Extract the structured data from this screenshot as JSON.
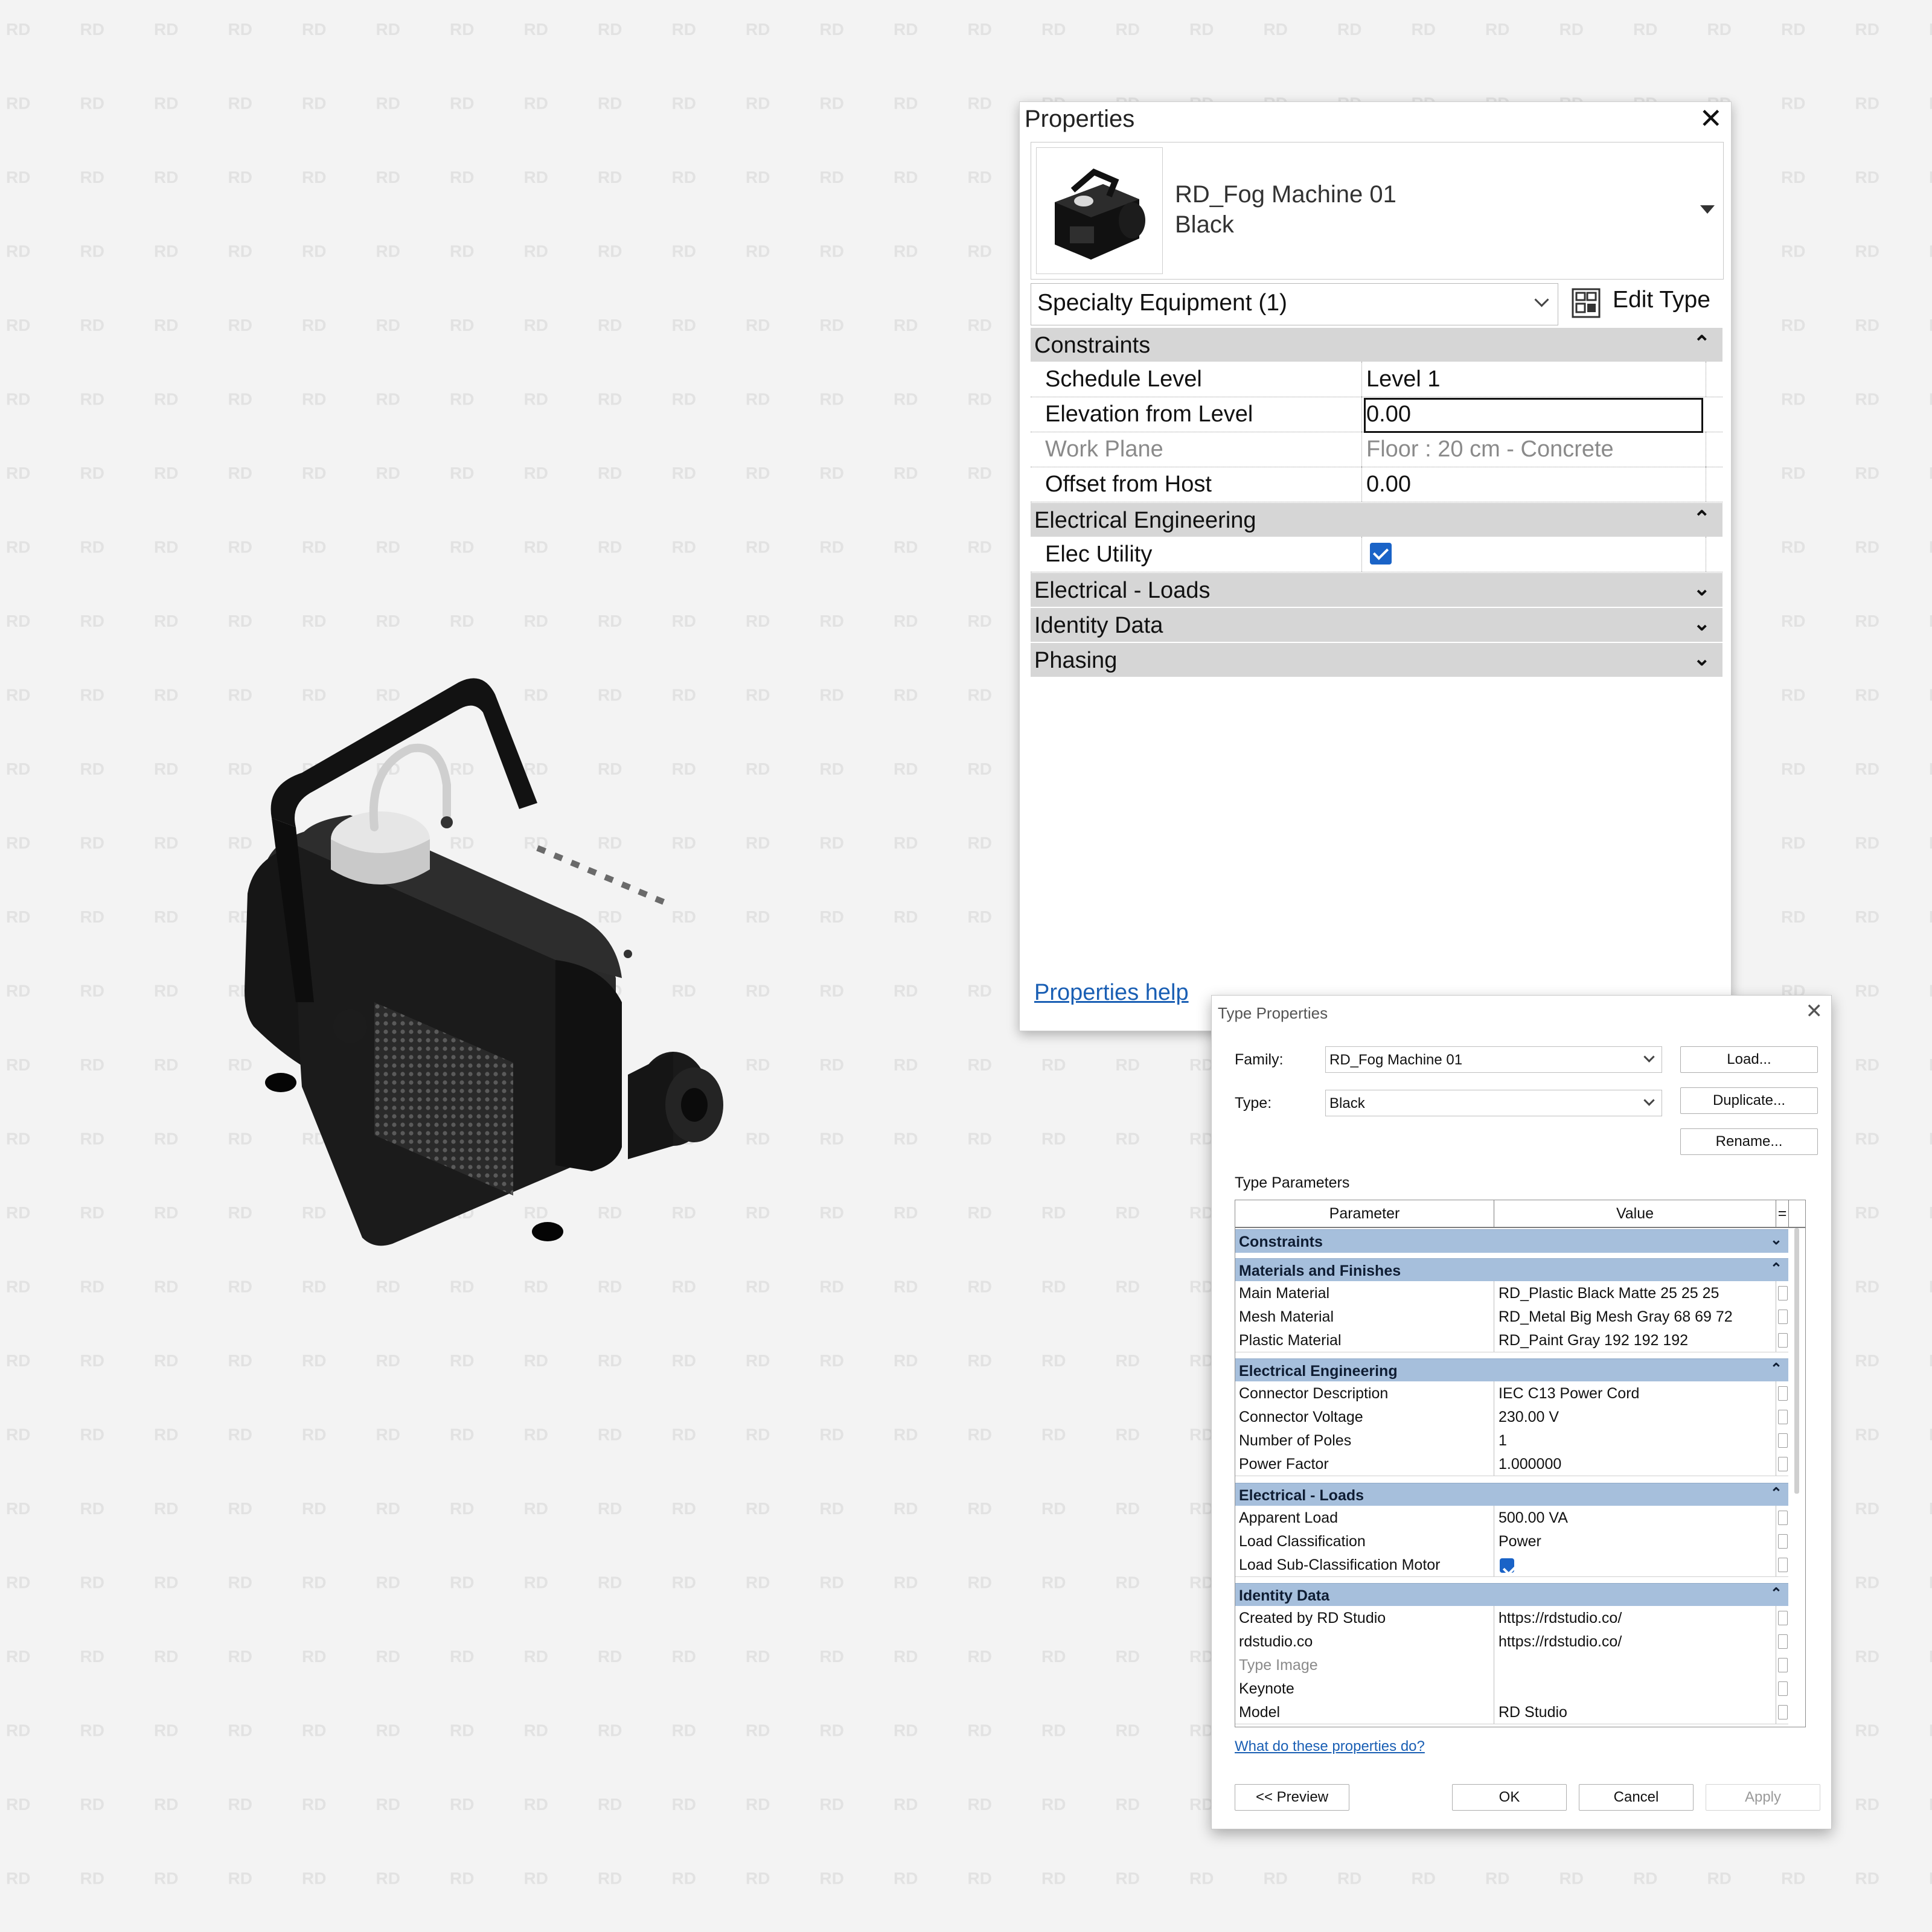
{
  "watermark": {
    "text": "RD"
  },
  "properties_palette": {
    "title": "Properties",
    "type_selector": {
      "family": "RD_Fog Machine 01",
      "type": "Black"
    },
    "category_filter": "Specialty Equipment (1)",
    "edit_type_label": "Edit Type",
    "groups": {
      "constraints": {
        "label": "Constraints",
        "expanded": true,
        "rows": [
          {
            "name": "Schedule Level",
            "value": "Level 1",
            "enabled": true
          },
          {
            "name": "Elevation from Level",
            "value": "0.00",
            "enabled": true
          },
          {
            "name": "Work Plane",
            "value": "Floor : 20 cm - Concrete",
            "enabled": false
          },
          {
            "name": "Offset from Host",
            "value": "0.00",
            "enabled": true
          }
        ]
      },
      "electrical_engineering": {
        "label": "Electrical Engineering",
        "expanded": true,
        "rows": [
          {
            "name": "Elec Utility",
            "checked": true
          }
        ]
      },
      "electrical_loads": {
        "label": "Electrical - Loads",
        "expanded": false
      },
      "identity_data": {
        "label": "Identity Data",
        "expanded": false
      },
      "phasing": {
        "label": "Phasing",
        "expanded": false
      }
    },
    "help_link": "Properties help"
  },
  "type_properties": {
    "title": "Type Properties",
    "family_label": "Family:",
    "family_value": "RD_Fog Machine 01",
    "type_label": "Type:",
    "type_value": "Black",
    "buttons": {
      "load": "Load...",
      "duplicate": "Duplicate...",
      "rename": "Rename..."
    },
    "type_parameters_label": "Type Parameters",
    "columns": {
      "parameter": "Parameter",
      "value": "Value",
      "extra": "="
    },
    "groups": {
      "constraints": {
        "label": "Constraints"
      },
      "materials": {
        "label": "Materials and Finishes",
        "rows": [
          {
            "name": "Main Material",
            "value": "RD_Plastic Black Matte 25 25 25"
          },
          {
            "name": "Mesh Material",
            "value": "RD_Metal Big Mesh Gray 68 69 72"
          },
          {
            "name": "Plastic Material",
            "value": "RD_Paint Gray 192 192 192"
          }
        ]
      },
      "electrical_engineering": {
        "label": "Electrical Engineering",
        "rows": [
          {
            "name": "Connector Description",
            "value": "IEC C13 Power Cord"
          },
          {
            "name": "Connector Voltage",
            "value": "230.00 V"
          },
          {
            "name": "Number of Poles",
            "value": "1"
          },
          {
            "name": "Power Factor",
            "value": "1.000000"
          }
        ]
      },
      "electrical_loads": {
        "label": "Electrical - Loads",
        "rows": [
          {
            "name": "Apparent Load",
            "value": "500.00 VA"
          },
          {
            "name": "Load Classification",
            "value": "Power"
          },
          {
            "name": "Load Sub-Classification Motor",
            "checked": true
          }
        ]
      },
      "identity_data": {
        "label": "Identity Data",
        "rows": [
          {
            "name": "Created by RD Studio",
            "value": "https://rdstudio.co/"
          },
          {
            "name": "rdstudio.co",
            "value": "https://rdstudio.co/"
          },
          {
            "name": "Type Image",
            "value": ""
          },
          {
            "name": "Keynote",
            "value": ""
          },
          {
            "name": "Model",
            "value": "RD Studio"
          }
        ]
      }
    },
    "help_link": "What do these properties do?",
    "footer_buttons": {
      "preview": "<< Preview",
      "ok": "OK",
      "cancel": "Cancel",
      "apply": "Apply"
    }
  },
  "icons": [
    "close-icon",
    "chevron-down-icon",
    "edit-type-icon",
    "collapse-icon",
    "expand-icon",
    "checkbox-checked-icon"
  ],
  "colors": {
    "checkbox_blue": "#1a63c7",
    "group_header_blue": "#a6bfdc",
    "link_blue": "#1a5fb4",
    "group_header_gray": "#d6d6d6"
  }
}
